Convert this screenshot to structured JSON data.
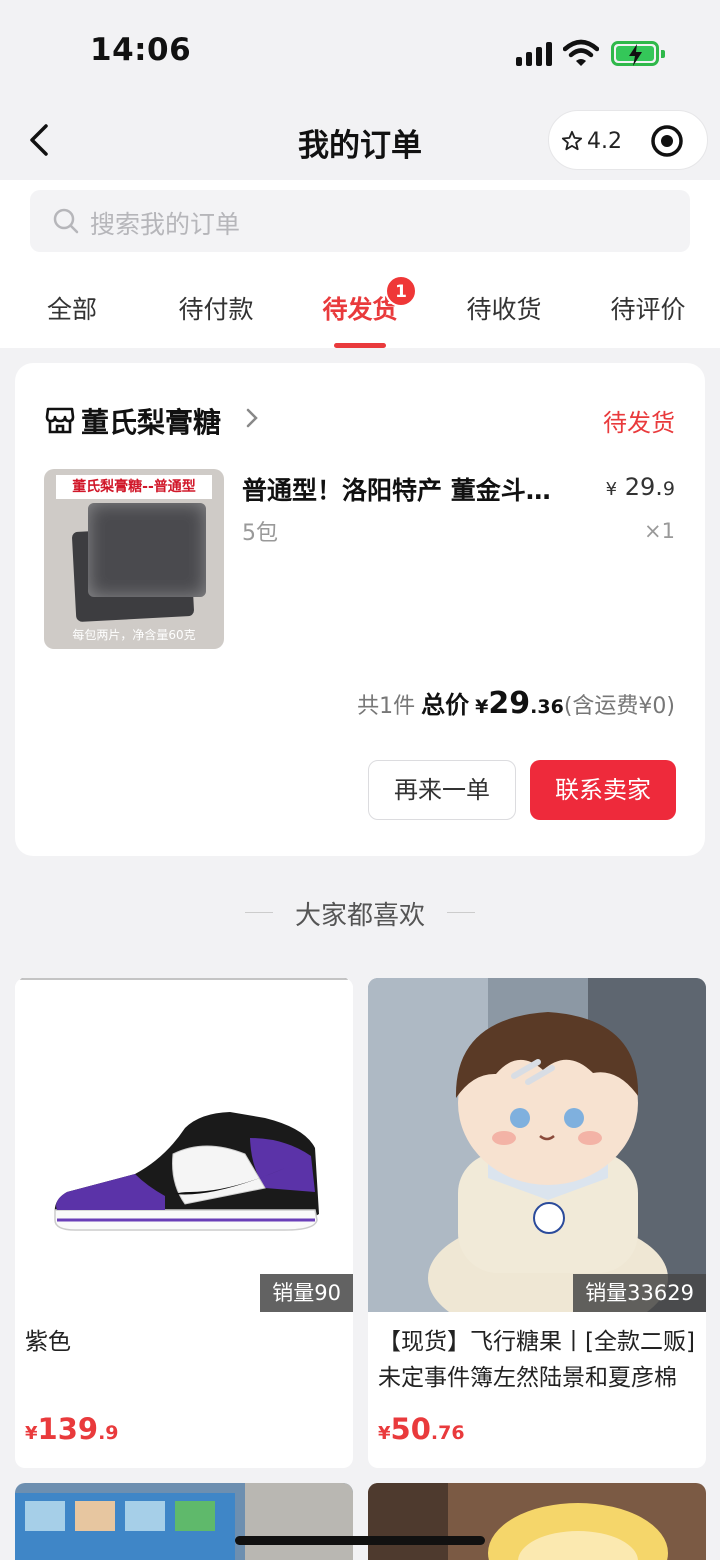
{
  "status_bar": {
    "time": "14:06"
  },
  "nav": {
    "title": "我的订单",
    "rating": "4.2"
  },
  "search": {
    "placeholder": "搜索我的订单"
  },
  "tabs": [
    {
      "label": "全部"
    },
    {
      "label": "待付款"
    },
    {
      "label": "待发货",
      "badge": "1",
      "active": true
    },
    {
      "label": "待收货"
    },
    {
      "label": "待评价"
    }
  ],
  "order": {
    "shop_name": "董氏梨膏糖",
    "status": "待发货",
    "product_image_caption": "董氏梨膏糖--普通型",
    "product_image_footer": "每包两片，净含量60克",
    "product_title": "普通型！洛阳特产 董金斗梨膏糖",
    "spec": "5包",
    "unit_price_symbol": "¥",
    "unit_price_int": "29.",
    "unit_price_dec": "9",
    "quantity": "×1",
    "summary_count": "共1件",
    "summary_total_label": "总价",
    "summary_symbol": "¥",
    "summary_int": "29",
    "summary_dec": ".36",
    "summary_shipping": "(含运费¥0)",
    "btn_again": "再来一单",
    "btn_contact": "联系卖家"
  },
  "recommend": {
    "heading": "大家都喜欢",
    "items": [
      {
        "sales": "销量90",
        "title": "紫色",
        "price_symbol": "¥",
        "price_int": "139",
        "price_dec": ".9"
      },
      {
        "sales": "销量33629",
        "title": "【现货】飞行糖果丨[全款二贩]未定事件簿左然陆景和夏彦棉花娃娃",
        "price_symbol": "¥",
        "price_int": "50",
        "price_dec": ".76"
      }
    ]
  },
  "colors": {
    "accent": "#e93a3c",
    "button_red": "#ee2a3b",
    "background": "#f2f2f4"
  }
}
